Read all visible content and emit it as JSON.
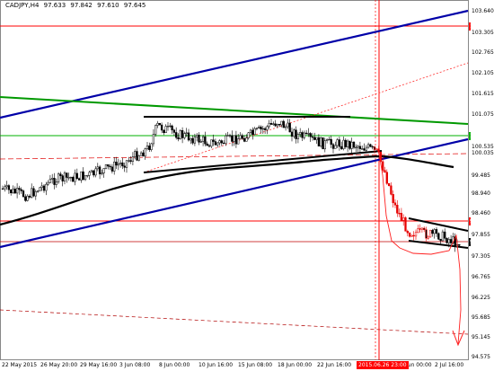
{
  "header": {
    "symbol_timeframe": "CADJPY,H4",
    "ohlc": [
      "97.633",
      "97.842",
      "97.610",
      "97.645"
    ]
  },
  "price_scale": [
    "103.640",
    "103.305",
    "102.765",
    "102.105",
    "101.615",
    "101.075",
    "100.535",
    "100.035",
    "99.485",
    "98.940",
    "98.460",
    "97.855",
    "97.305",
    "96.765",
    "96.225",
    "95.685",
    "95.145",
    "94.575"
  ],
  "time_scale": [
    "22 May 2015",
    "26 May 20:00",
    "29 May 16:00",
    "3 Jun 08:00",
    "8 Jun 00:00",
    "10 Jun 16:00",
    "15 Jun 08:00",
    "18 Jun 00:00",
    "22 Jun 16:00",
    "Jun 00:00",
    "2 Jul 16:00"
  ],
  "price_tags": {
    "upper_level": "103.445",
    "green_level": "100.560",
    "red_level": "98.235",
    "current_price": "97.645"
  },
  "time_marker": "2015.06.26 23:00",
  "colors": {
    "background": "#ffffff",
    "bull_candle": "#000000",
    "bear_candle": "#e60000",
    "horizontal_red": "#ff0000",
    "horizontal_green": "#00b000",
    "channel_blue": "#0000a8",
    "trend_green": "#009900",
    "moving_average": "#000000",
    "projection": "#ff2020",
    "current_price_tag": "#000000"
  },
  "chart_data": {
    "type": "candlestick",
    "instrument": "CADJPY",
    "timeframe": "H4",
    "ylim": [
      94.575,
      103.9
    ],
    "last_price": 97.645,
    "overlays": [
      "horizontal levels",
      "ascending channel",
      "trend line",
      "moving average",
      "projection path"
    ]
  }
}
